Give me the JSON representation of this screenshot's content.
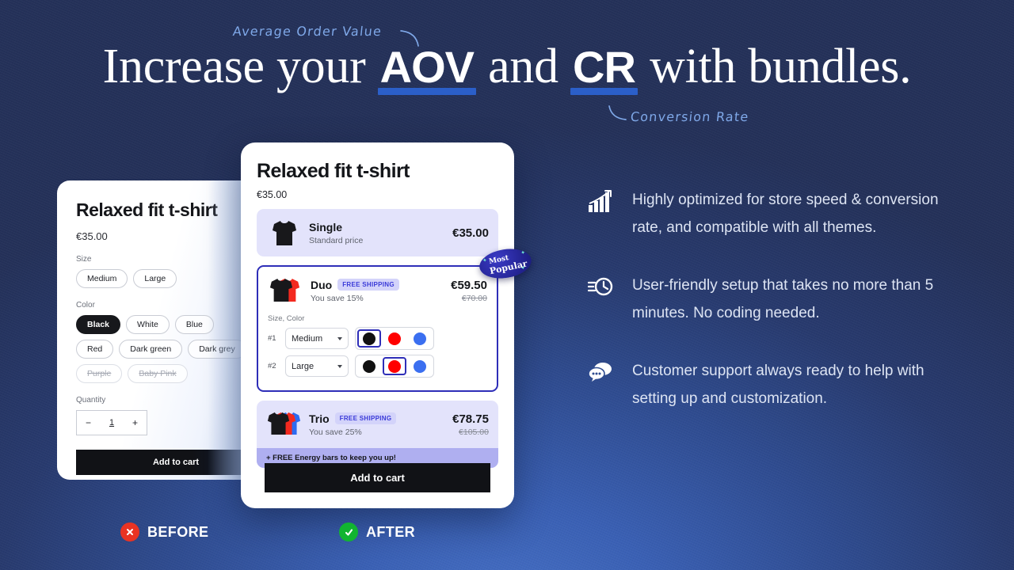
{
  "theme": {
    "bg_dark": "#243159",
    "bg_light": "#4670C6",
    "accent_blue": "#2B5FC9",
    "bundle_purple": "#E3E3FB",
    "bundle_border": "#2E2EB8",
    "banner_purple": "#AFAFF0",
    "red": "#E93323",
    "green": "#11B431",
    "swatch_black": "#111111",
    "swatch_red": "#FF0000",
    "swatch_blue": "#3B6FF0"
  },
  "headline": {
    "part1": "Increase your ",
    "aov": "AOV",
    "part2": " and ",
    "cr": "CR",
    "part3": " with bundles."
  },
  "annotations": {
    "aov_note": "Average Order Value",
    "cr_note": "Conversion Rate"
  },
  "before_card": {
    "title": "Relaxed fit t-shirt",
    "price": "€35.00",
    "size_label": "Size",
    "sizes": [
      {
        "label": "Medium",
        "state": "default"
      },
      {
        "label": "Large",
        "state": "default"
      }
    ],
    "color_label": "Color",
    "colors": [
      {
        "label": "Black",
        "state": "selected"
      },
      {
        "label": "White",
        "state": "default"
      },
      {
        "label": "Blue",
        "state": "default"
      },
      {
        "label": "Red",
        "state": "default"
      },
      {
        "label": "Dark green",
        "state": "default"
      },
      {
        "label": "Dark grey",
        "state": "default"
      },
      {
        "label": "Purple",
        "state": "unavailable"
      },
      {
        "label": "Baby Pink",
        "state": "unavailable"
      }
    ],
    "quantity_label": "Quantity",
    "quantity_minus": "−",
    "quantity_value": "1",
    "quantity_plus": "+",
    "add_to_cart": "Add to cart"
  },
  "after_card": {
    "title": "Relaxed fit t-shirt",
    "price": "€35.00",
    "add_to_cart": "Add to cart",
    "most_popular_badge": {
      "line1": "Most",
      "line2": "Popular"
    },
    "bundles": [
      {
        "name": "Single",
        "subtitle": "Standard price",
        "price": "€35.00",
        "compare_at": "",
        "badge": ""
      },
      {
        "name": "Duo",
        "subtitle": "You save 15%",
        "price": "€59.50",
        "compare_at": "€70.00",
        "badge": "FREE SHIPPING",
        "variant_label": "Size, Color",
        "variants": [
          {
            "num": "#1",
            "size": "Medium",
            "selected_color": "black"
          },
          {
            "num": "#2",
            "size": "Large",
            "selected_color": "red"
          }
        ]
      },
      {
        "name": "Trio",
        "subtitle": "You save 25%",
        "price": "€78.75",
        "compare_at": "€105.00",
        "badge": "FREE SHIPPING",
        "banner": "+ FREE Energy bars to keep you up!"
      }
    ]
  },
  "features": [
    {
      "icon": "growth-chart-icon",
      "text": "Highly optimized for store speed & conversion rate, and compatible with all themes."
    },
    {
      "icon": "fast-clock-icon",
      "text": "User-friendly setup that takes no more than 5 minutes. No coding needed."
    },
    {
      "icon": "chat-support-icon",
      "text": "Customer support always ready to help with setting up and customization."
    }
  ],
  "footer": {
    "before_label": "BEFORE",
    "before_icon": "cross-circle-icon",
    "after_label": "AFTER",
    "after_icon": "check-circle-icon"
  }
}
